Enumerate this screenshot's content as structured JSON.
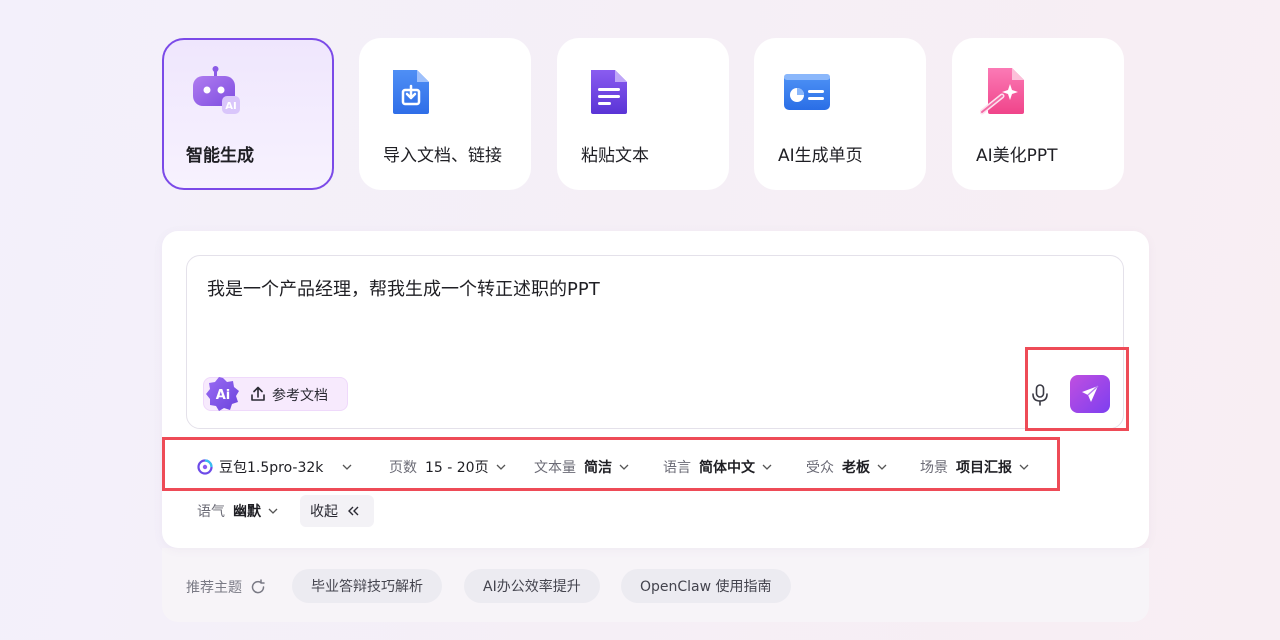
{
  "cards": [
    {
      "label": "智能生成",
      "icon": "robot-ai-icon",
      "active": true
    },
    {
      "label": "导入文档、链接",
      "icon": "import-doc-icon"
    },
    {
      "label": "粘贴文本",
      "icon": "paste-text-icon"
    },
    {
      "label": "AI生成单页",
      "icon": "single-page-icon"
    },
    {
      "label": "AI美化PPT",
      "icon": "beautify-wand-icon"
    }
  ],
  "prompt": {
    "text": "我是一个产品经理，帮我生成一个转正述职的PPT"
  },
  "reference": {
    "badge": "Ai",
    "label": "参考文档"
  },
  "options": {
    "model": {
      "value": "豆包1.5pro-32k"
    },
    "pages": {
      "key": "页数",
      "value": "15 - 20页"
    },
    "text_amount": {
      "key": "文本量",
      "value": "简洁"
    },
    "language": {
      "key": "语言",
      "value": "简体中文"
    },
    "audience": {
      "key": "受众",
      "value": "老板"
    },
    "scene": {
      "key": "场景",
      "value": "项目汇报"
    },
    "tone": {
      "key": "语气",
      "value": "幽默"
    },
    "collapse": {
      "label": "收起",
      "icon": "double-chevron-left-icon"
    }
  },
  "recommend": {
    "label": "推荐主题",
    "topics": [
      "毕业答辩技巧解析",
      "AI办公效率提升",
      "OpenClaw 使用指南"
    ]
  },
  "colors": {
    "accent": "#7b4ae8",
    "highlight_box": "#ee4b57",
    "send_gradient": [
      "#c04fe0",
      "#7d3ff0"
    ]
  }
}
